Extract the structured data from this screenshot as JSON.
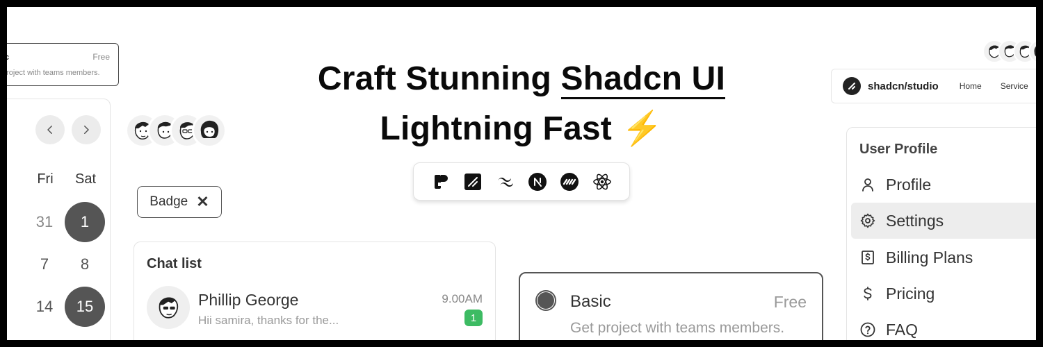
{
  "headline": {
    "line1_prefix": "Craft Stunning ",
    "line1_highlight": "Shadcn UI",
    "line2": "Lightning Fast",
    "emoji": "⚡"
  },
  "tech_stack": {
    "icons": [
      "framer-icon",
      "shadcn-icon",
      "tailwind-icon",
      "nextjs-icon",
      "motion-icon",
      "react-icon"
    ]
  },
  "mini_plan": {
    "name": "ic",
    "price": "Free",
    "description": "project with teams members."
  },
  "calendar": {
    "headers": [
      "Fri",
      "Sat"
    ],
    "rows": [
      [
        "31",
        "1"
      ],
      [
        "7",
        "8"
      ],
      [
        "14",
        "15"
      ]
    ],
    "selected": [
      "1",
      "15"
    ]
  },
  "badge": {
    "label": "Badge",
    "close": "✕"
  },
  "chat_list": {
    "title": "Chat list",
    "items": [
      {
        "name": "Phillip George",
        "message": "Hii samira, thanks for the...",
        "time": "9.00AM",
        "unread": "1"
      }
    ]
  },
  "plan_card": {
    "name": "Basic",
    "price": "Free",
    "description": "Get project with teams members.",
    "selected": true
  },
  "navbar": {
    "brand": "shadcn/studio",
    "links": [
      "Home",
      "Service"
    ]
  },
  "profile_menu": {
    "title": "User Profile",
    "items": [
      {
        "label": "Profile",
        "icon": "user-icon"
      },
      {
        "label": "Settings",
        "icon": "gear-icon",
        "active": true
      },
      {
        "label": "Billing Plans",
        "icon": "billing-icon"
      },
      {
        "label": "Pricing",
        "icon": "dollar-icon"
      },
      {
        "label": "FAQ",
        "icon": "help-icon"
      }
    ]
  },
  "colors": {
    "frame": "#000000",
    "accent_dark": "#555555",
    "unread_badge": "#3dbb63",
    "bolt": "#f5b400"
  }
}
